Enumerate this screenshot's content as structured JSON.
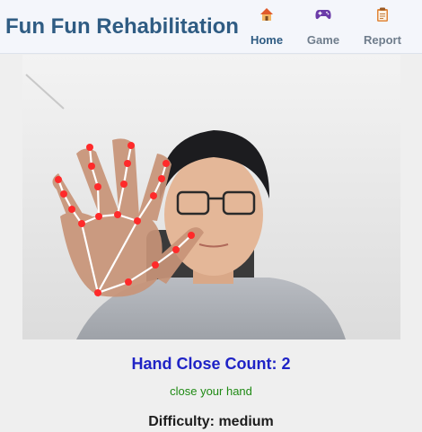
{
  "header": {
    "title": "Fun Fun Rehabilitation",
    "nav": [
      {
        "label": "Home",
        "icon": "house-icon",
        "active": true
      },
      {
        "label": "Game",
        "icon": "gamepad-icon",
        "active": false
      },
      {
        "label": "Report",
        "icon": "clipboard-icon",
        "active": false
      }
    ]
  },
  "camera": {
    "feed": "webcam-feed",
    "overlay": "hand-landmarks",
    "landmark_color": "#ff2a2a",
    "connection_color": "#ffffff"
  },
  "status": {
    "count_text": "Hand Close Count: 2",
    "instruction": "close your hand",
    "difficulty_text": "Difficulty: medium"
  },
  "colors": {
    "title": "#2f5c83",
    "count": "#1f23c6",
    "instruction": "#1f8a14"
  }
}
